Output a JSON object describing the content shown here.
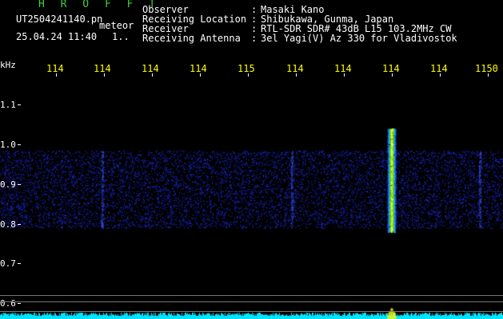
{
  "header": {
    "brand": "H R O F F T",
    "filename": "UT2504241140.pn",
    "tag": "meteor",
    "datetime": "25.04.24 11:40",
    "count": "1.."
  },
  "info": [
    {
      "label": "Observer",
      "value": "Masaki Kano"
    },
    {
      "label": "Receiving Location",
      "value": "Shibukawa, Gunma, Japan"
    },
    {
      "label": "Receiver",
      "value": "RTL-SDR SDR# 43dB L15 103.2MHz CW"
    },
    {
      "label": "Receiving Antenna",
      "value": "3el Yagi(V) Az 330 for Vladivostok"
    }
  ],
  "axis": {
    "unit": "kHz",
    "freq_labels": [
      "114",
      "114",
      "114",
      "114",
      "115",
      "114",
      "114",
      "114",
      "114",
      "1150"
    ],
    "y_labels": [
      "1.1",
      "1.0",
      "0.9",
      "0.8",
      "0.7",
      "0.6"
    ]
  },
  "colors": {
    "brand": "#3cd23c",
    "freq_label": "#ffff00",
    "baseline": "#00e5ff",
    "noise": "#1a2cff"
  },
  "meteor_echo": {
    "frequency_position": 0.775,
    "from_khz": 1.04,
    "to_khz": 0.78
  }
}
